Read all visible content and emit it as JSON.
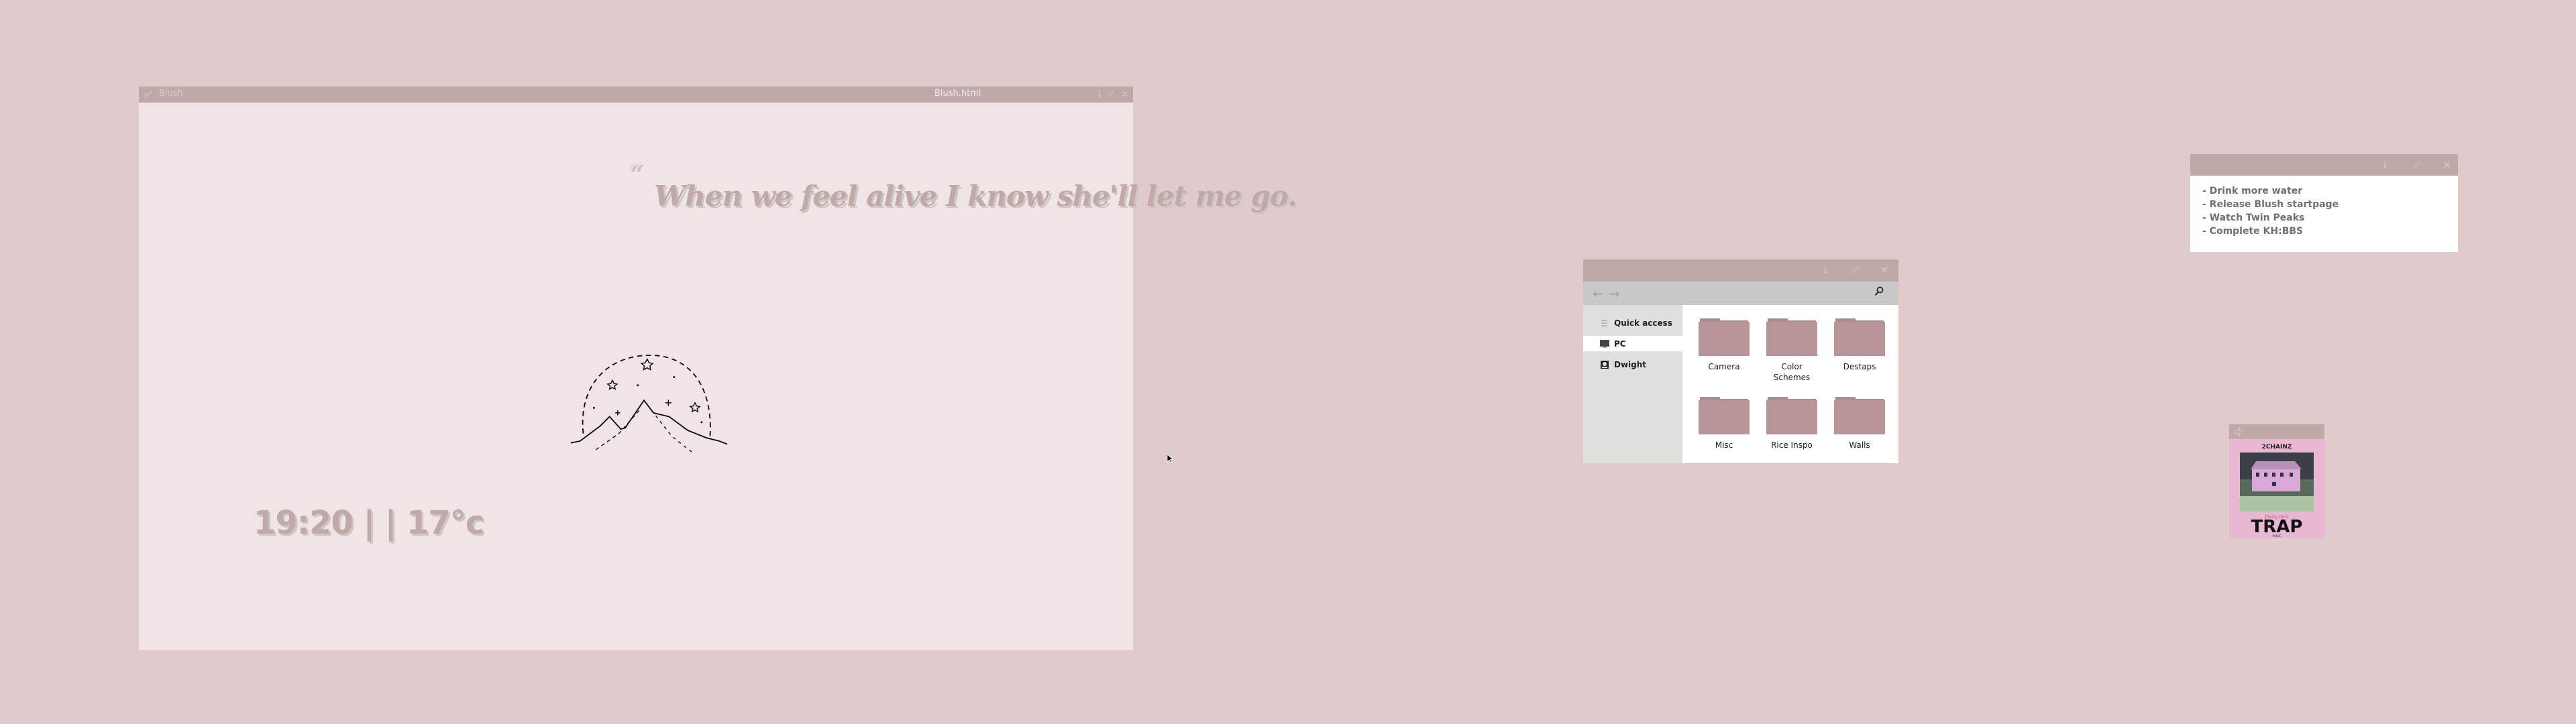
{
  "desktop": {
    "background_color": "#e0cacb",
    "cursor": "arrow-pointer"
  },
  "blush_window": {
    "app_name": "Blush",
    "document_title": "Blush.html",
    "controls": {
      "minimize": "↓",
      "maximize": "⤢",
      "close": "✕"
    },
    "quote_mark": "“",
    "quote": "When we feel alive I know she'll let me go.",
    "clock": "19:20 | | 17°c",
    "illustration": "mountain-moon-stars"
  },
  "explorer_window": {
    "controls": {
      "minimize": "↓",
      "maximize": "⤢",
      "close": "✕"
    },
    "nav": {
      "back": "←",
      "forward": "→",
      "search": "⌕"
    },
    "sidebar": [
      {
        "label": "Quick access",
        "icon": "list-icon",
        "active": false
      },
      {
        "label": "PC",
        "icon": "monitor-icon",
        "active": true
      },
      {
        "label": "Dwight",
        "icon": "user-drive-icon",
        "active": false
      }
    ],
    "folders": [
      {
        "label": "Camera"
      },
      {
        "label": "Color Schemes"
      },
      {
        "label": "Destaps"
      },
      {
        "label": "Misc"
      },
      {
        "label": "Rice Inspo"
      },
      {
        "label": "Walls"
      }
    ]
  },
  "notes_window": {
    "controls": {
      "minimize": "↓",
      "maximize": "⤢",
      "close": "✕"
    },
    "items": [
      "- Drink more water",
      "- Release Blush startpage",
      "- Watch Twin Peaks",
      "- Complete KH:BBS"
    ]
  },
  "music_widget": {
    "album_artist": "2CHAINZ",
    "album_title": "TRAP",
    "album_subtitle": "Pretty Girls",
    "album_footer": "MUSIC"
  },
  "colors": {
    "titlebar": "#bca9a8",
    "folder": "#b89397",
    "window_bg": "#f0e5e4",
    "text_accent": "#c1a9a8"
  }
}
